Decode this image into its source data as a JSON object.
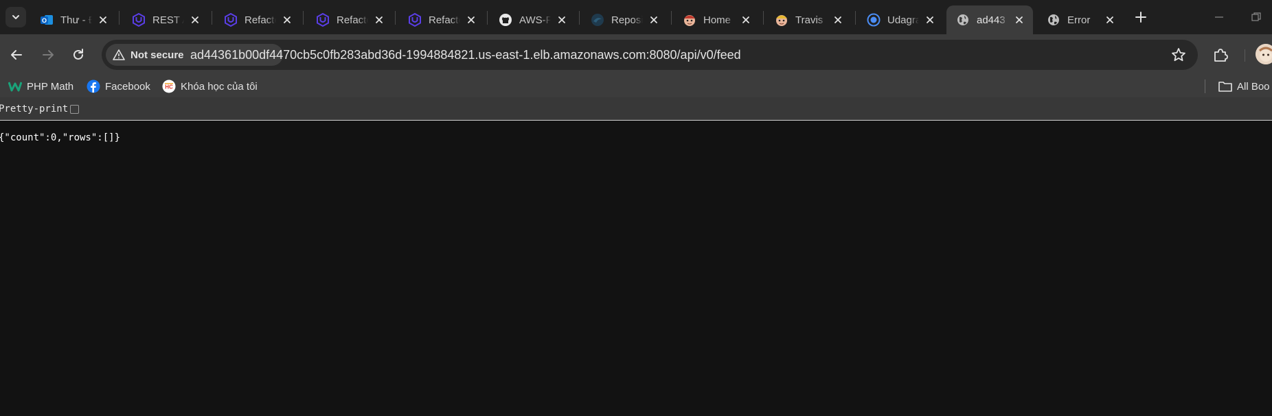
{
  "tabs": [
    {
      "title": "Thư - Đ",
      "icon": "outlook-icon",
      "active": false
    },
    {
      "title": "REST A",
      "icon": "udacity-icon",
      "active": false
    },
    {
      "title": "Refacto",
      "icon": "udacity-icon",
      "active": false
    },
    {
      "title": "Refacto",
      "icon": "udacity-icon",
      "active": false
    },
    {
      "title": "Refacto",
      "icon": "udacity-icon",
      "active": false
    },
    {
      "title": "AWS-F",
      "icon": "github-icon",
      "active": false
    },
    {
      "title": "Reposi",
      "icon": "repository-icon",
      "active": false
    },
    {
      "title": "Home",
      "icon": "travis-icon",
      "active": false
    },
    {
      "title": "Travis",
      "icon": "travis-icon",
      "active": false
    },
    {
      "title": "Udagra",
      "icon": "udagram-icon",
      "active": false
    },
    {
      "title": "ad443",
      "icon": "globe-icon",
      "active": true
    },
    {
      "title": "Error",
      "icon": "globe-icon",
      "active": false
    }
  ],
  "omnibox": {
    "security_label": "Not secure",
    "url": "ad44361b00df4470cb5c0fb283abd36d-1994884821.us-east-1.elb.amazonaws.com:8080/api/v0/feed"
  },
  "bookmarks": [
    {
      "label": "PHP Math",
      "icon": "php-math-icon"
    },
    {
      "label": "Facebook",
      "icon": "facebook-icon"
    },
    {
      "label": "Khóa học của tôi",
      "icon": "course-icon"
    }
  ],
  "bookmarks_folder": {
    "label": "All Boo",
    "icon": "folder-icon"
  },
  "page": {
    "pretty_print_label": "Pretty-print",
    "pretty_print_checked": false,
    "json_text": "{\"count\":0,\"rows\":[]}"
  },
  "colors": {
    "tabstrip_bg": "#1f1f1f",
    "toolbar_bg": "#3c3c3c",
    "page_bg": "#121212",
    "udacity_purple": "#5a3ee6",
    "facebook_blue": "#1877f2"
  }
}
